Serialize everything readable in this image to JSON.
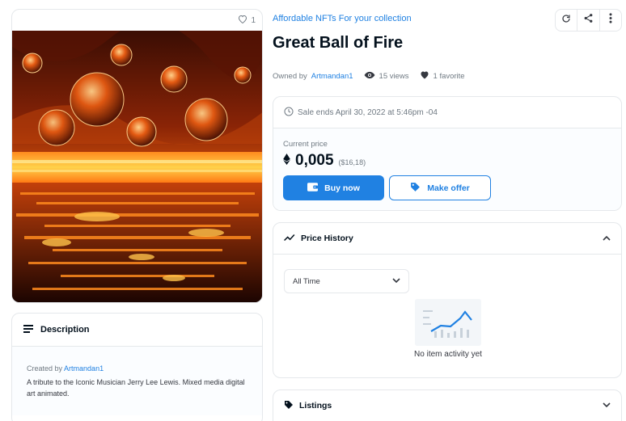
{
  "image_card": {
    "favorite_count": "1"
  },
  "description": {
    "heading": "Description",
    "created_by_prefix": "Created by",
    "creator": "Artmandan1",
    "text": "A tribute to the Iconic Musician Jerry Lee Lewis. Mixed media digital art animated."
  },
  "header": {
    "collection": "Affordable NFTs For your collection",
    "title": "Great Ball of Fire",
    "owned_by_prefix": "Owned by",
    "owner": "Artmandan1",
    "views": "15 views",
    "favorites": "1 favorite"
  },
  "sale": {
    "ends_text": "Sale ends April 30, 2022 at 5:46pm -04",
    "current_price_label": "Current price",
    "price_eth": "0,005",
    "price_usd": "($16,18)",
    "buy_label": "Buy now",
    "offer_label": "Make offer"
  },
  "price_history": {
    "heading": "Price History",
    "time_filter": "All Time",
    "empty_text": "No item activity yet"
  },
  "listings": {
    "heading": "Listings"
  },
  "colors": {
    "accent": "#2081e2",
    "border": "#e5e8eb",
    "muted": "#707a83"
  },
  "icons": [
    "heart-icon",
    "refresh-icon",
    "share-icon",
    "more-icon",
    "eye-icon",
    "clock-icon",
    "ethereum-icon",
    "wallet-icon",
    "tag-icon",
    "trend-icon",
    "chevron-up-icon",
    "chevron-down-icon",
    "description-icon"
  ]
}
